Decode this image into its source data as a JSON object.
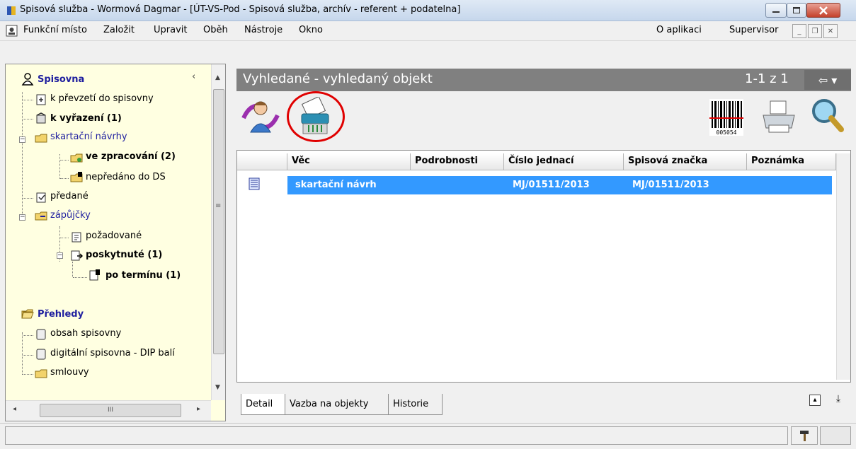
{
  "window": {
    "title": "Spisová služba - Wormová Dagmar - [ÚT-VS-Pod - Spisová služba, archív - referent + podatelna]"
  },
  "menu": {
    "items": [
      "Funkční místo",
      "Založit",
      "Upravit",
      "Oběh",
      "Nástroje",
      "Okno"
    ],
    "right_items": [
      "O aplikaci",
      "Supervisor"
    ]
  },
  "tree": {
    "spisovna": {
      "header": "Spisovna",
      "k_prevzeti": "k převzetí do spisovny",
      "k_vyrizeni": "k vyřazení (1)",
      "skartacni_navrhy": "skartační návrhy",
      "ve_zpracovani": "ve zpracování (2)",
      "nepredano": "nepředáno do DS",
      "predane": "předané",
      "zapujcky": "zápůjčky",
      "pozadovane": "požadované",
      "poskytnute": "poskytnuté (1)",
      "po_terminu": "po termínu (1)"
    },
    "prehledy": {
      "header": "Přehledy",
      "obsah": "obsah spisovny",
      "digitalni": "digitální spisovna - DIP balí",
      "smlouvy": "smlouvy"
    },
    "hscroll_grip": "III"
  },
  "panel": {
    "title": "Vyhledané - vyhledaný objekt",
    "counter": "1-1 z 1",
    "nav_arrow": "⇦ ▾"
  },
  "table": {
    "columns": [
      "Věc",
      "Podrobnosti",
      "Číslo jednací",
      "Spisová značka",
      "Poznámka"
    ],
    "rows": [
      {
        "vec": "skartační návrh",
        "podrobnosti": "",
        "cislo_jednaci": "MJ/01511/2013",
        "spisova_znacka": "MJ/01511/2013",
        "poznamka": ""
      }
    ]
  },
  "tabs": [
    "Detail",
    "Vazba na objekty",
    "Historie"
  ],
  "barcode_text": "005054",
  "colors": {
    "selection": "#3399ff",
    "panel_header": "#808080",
    "tree_background": "#ffffe1",
    "highlight_circle": "#e00000"
  }
}
